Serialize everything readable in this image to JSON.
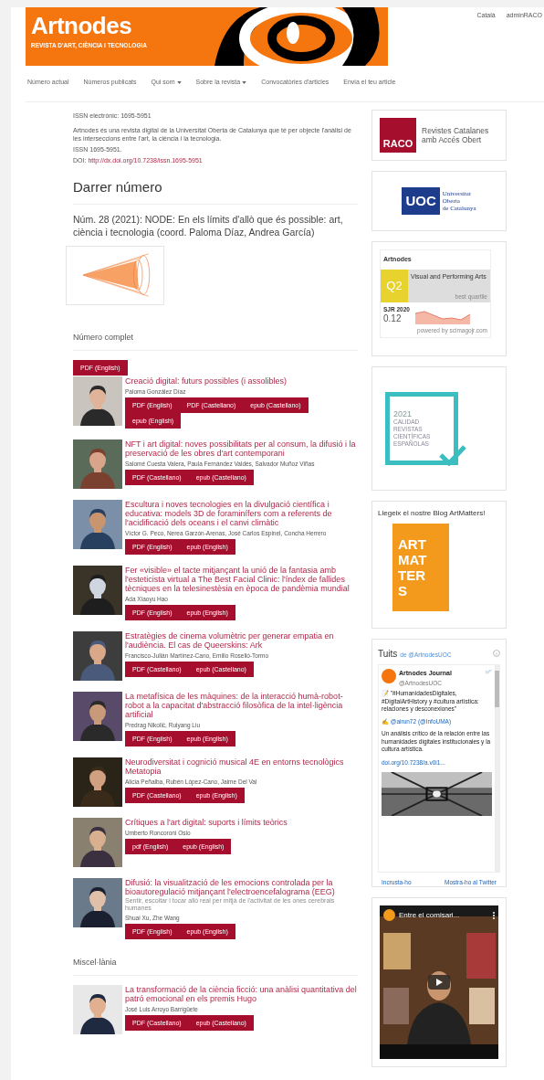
{
  "header": {
    "title": "Artnodes",
    "subtitle": "REVISTA D'ART, CIÈNCIA I TECNOLOGIA",
    "top_links": [
      "Català",
      "adminRACO"
    ]
  },
  "nav": [
    {
      "label": "Número actual",
      "dropdown": false
    },
    {
      "label": "Números publicats",
      "dropdown": false
    },
    {
      "label": "Qui som",
      "dropdown": true
    },
    {
      "label": "Sobre la revista",
      "dropdown": true
    },
    {
      "label": "Convocatòries d'articles",
      "dropdown": false
    },
    {
      "label": "Envia el teu article",
      "dropdown": false
    }
  ],
  "intro": {
    "issn_electronic": "ISSN electrònic: 1695-5951",
    "description": "Artnodes és una revista digital de la Universitat Oberta de Catalunya que té per objecte l'anàlisi de les interseccions entre l'art, la ciència i la tecnologia.",
    "issn": "ISSN 1695-5951.",
    "doi_label": "DOI:",
    "doi_link": "http://dx.doi.org/10.7238/issn.1695-5951"
  },
  "latest": {
    "heading": "Darrer número",
    "issue_title": "Núm. 28 (2021): NODE: En els límits d'allò que és possible: art, ciència i tecnologia (coord. Paloma Díaz, Andrea García)"
  },
  "full_issue": {
    "heading": "Número complet",
    "galleys": [
      "PDF (English)"
    ]
  },
  "articles": [
    {
      "title": "Creació digital: futurs possibles (i assolibles)",
      "authors": "Paloma González Díaz",
      "galleys": [
        "PDF (English)",
        "PDF (Castellano)",
        "epub (Castellano)",
        "epub (English)"
      ]
    },
    {
      "title": "NFT i art digital: noves possibilitats per al consum, la difusió i la preservació de les obres d'art contemporani",
      "authors": "Salomé Cuesta Valera, Paula Fernández Valdés, Salvador Muñoz Viñas",
      "galleys": [
        "PDF (Castellano)",
        "epub (Castellano)"
      ]
    },
    {
      "title": "Escultura i noves tecnologies en la divulgació científica i educativa: models 3D de foraminífers com a referents de l'acidificació dels oceans i el canvi climàtic",
      "authors": "Víctor G. Peco, Nerea Garzón-Arenas, José Carlos Espinel, Concha Herrero",
      "galleys": [
        "PDF (English)",
        "epub (English)"
      ]
    },
    {
      "title": "Fer «visible» el tacte mitjançant la unió de la fantasia amb l'esteticista virtual a The Best Facial Clinic: l'índex de fallides tècniques en la telesinestèsia en època de pandèmia mundial",
      "authors": "Ada Xiaoyu Hao",
      "galleys": [
        "PDF (English)",
        "epub (English)"
      ]
    },
    {
      "title": "Estratègies de cinema volumètric per generar empatia en l'audiència. El cas de Queerskins: Ark",
      "authors": "Francisco-Julián Martínez-Cano, Emilio Roselló-Tormo",
      "galleys": [
        "PDF (Castellano)",
        "epub (Castellano)"
      ]
    },
    {
      "title": "La metafísica de les màquines: de la interacció humà-robot-robot a la capacitat d'abstracció filosòfica de la intel·ligència artificial",
      "authors": "Predrag Nikolić, Ruiyang Liu",
      "galleys": [
        "PDF (English)",
        "epub (English)"
      ]
    },
    {
      "title": "Neurodiversitat i cognició musical 4E en entorns tecnològics Metatopia",
      "authors": "Alicia Peñalba, Rubén López-Cano, Jaime Del Val",
      "galleys": [
        "PDF (Castellano)",
        "epub (English)"
      ]
    },
    {
      "title": "Crítiques a l'art digital: suports i límits teòrics",
      "authors": "Umberto Roncoroni Osio",
      "galleys": [
        "pdf (English)",
        "epub (English)"
      ]
    },
    {
      "title": "Difusió: la visualització de les emocions controlada per la bioautoregulació mitjançant l'electroencefalograma (EEG)",
      "subtitle": "Sentir, escoltar i tocar allò real per mitjà de l'activitat de les ones cerebrals humanes",
      "authors": "Shuai Xu, Zhe Wang",
      "galleys": [
        "PDF (English)",
        "epub (English)"
      ]
    }
  ],
  "misc": {
    "heading": "Miscel·lània",
    "articles": [
      {
        "title": "La transformació de la ciència ficció: una anàlisi quantitativa del patró emocional en els premis Hugo",
        "authors": "José Luis Arroyo Barrigüete",
        "galleys": [
          "PDF (Castellano)",
          "epub (Castellano)"
        ]
      }
    ]
  },
  "sidebar": {
    "raco": {
      "mark": "RACO",
      "lines": [
        "Revistes Catalanes",
        "amb Accés Obert"
      ]
    },
    "uoc": {
      "mark": "UOC",
      "lines": [
        "Universitat",
        "Oberta",
        "de Catalunya"
      ]
    },
    "sjr": {
      "journal": "Artnodes",
      "quartile": "Q2",
      "category": "Visual and Performing Arts",
      "quartile_note": "best quartile",
      "year": "SJR 2020",
      "value": "0.12",
      "powered": "powered by scimagojr.com"
    },
    "seal": {
      "year": "2021",
      "lines": [
        "CALIDAD",
        "REVISTAS",
        "CIENTÍFICAS",
        "ESPAÑOLAS"
      ]
    },
    "blog": {
      "heading": "Llegeix el nostre Blog ArtMatters!",
      "logo_lines": [
        "ART",
        "MAT",
        "TER",
        "S"
      ]
    },
    "tweets": {
      "title": "Tuits",
      "by": "de @ArtnodesUOC",
      "tweet": {
        "name": "Artnodes Journal",
        "handle": "@ArtnodesUOC",
        "text": "📝 \"#HumanidadesDigitales, #DigitalArtHistory y #cultura artística: relaciones y desconexiones\"",
        "mention": "✍️ @airun72 (@InfoUMA)",
        "body": "Un análisis crítico de la relación entre las humanidades digitales institucionales y la cultura artística.",
        "link": "doi.org/10.7238/a.v0i1..."
      },
      "actions": [
        "Incrusta-ho",
        "Mostra-ho al Twitter"
      ]
    },
    "video": {
      "title": "Entre el comisari..."
    }
  }
}
